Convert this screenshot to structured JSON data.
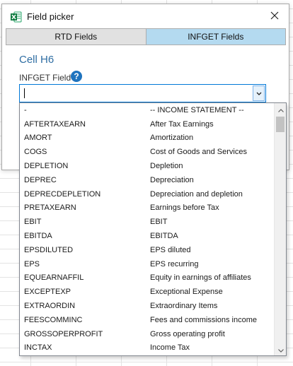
{
  "window": {
    "title": "Field picker",
    "app_icon": "excel-icon",
    "close_icon": "close-icon"
  },
  "tabs": [
    {
      "label": "RTD Fields",
      "active": false
    },
    {
      "label": "INFGET Fields",
      "active": true
    }
  ],
  "cell_label": "Cell H6",
  "field_label": "INFGET Field",
  "help_icon_glyph": "?",
  "combo": {
    "value": "",
    "dropdown_icon": "chevron-down-icon"
  },
  "colors": {
    "active_tab": "#b4daf0",
    "accent": "#1e73be",
    "cell_label": "#2f6ea3"
  },
  "dropdown_items": [
    {
      "code": "-",
      "desc": "-- INCOME STATEMENT --"
    },
    {
      "code": "AFTERTAXEARN",
      "desc": "After Tax Earnings"
    },
    {
      "code": "AMORT",
      "desc": "Amortization"
    },
    {
      "code": "COGS",
      "desc": "Cost of Goods and Services"
    },
    {
      "code": "DEPLETION",
      "desc": "Depletion"
    },
    {
      "code": "DEPREC",
      "desc": "Depreciation"
    },
    {
      "code": "DEPRECDEPLETION",
      "desc": "Depreciation and depletion"
    },
    {
      "code": "PRETAXEARN",
      "desc": "Earnings before Tax"
    },
    {
      "code": "EBIT",
      "desc": "EBIT"
    },
    {
      "code": "EBITDA",
      "desc": "EBITDA"
    },
    {
      "code": "EPSDILUTED",
      "desc": "EPS diluted"
    },
    {
      "code": "EPS",
      "desc": "EPS recurring"
    },
    {
      "code": "EQUEARNAFFIL",
      "desc": "Equity in earnings of affiliates"
    },
    {
      "code": "EXCEPTEXP",
      "desc": "Exceptional Expense"
    },
    {
      "code": "EXTRAORDIN",
      "desc": "Extraordinary Items"
    },
    {
      "code": "FEESCOMMINC",
      "desc": "Fees and commissions income"
    },
    {
      "code": "GROSSOPERPROFIT",
      "desc": "Gross operating profit"
    },
    {
      "code": "INCTAX",
      "desc": "Income Tax"
    }
  ]
}
